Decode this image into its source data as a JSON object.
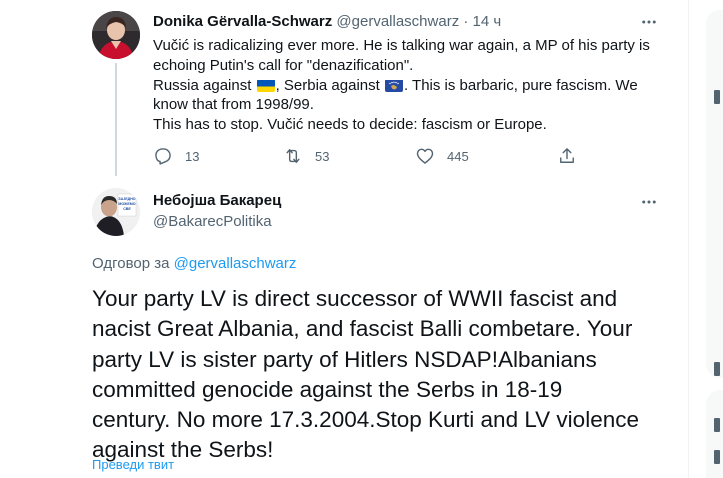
{
  "tweet": {
    "author_name": "Donika Gërvalla-Schwarz",
    "author_handle": "@gervallaschwarz",
    "separator": "·",
    "time": "14 ч",
    "text": {
      "line1": "Vučić is radicalizing ever more. He is talking war again, a MP of his party is",
      "line2": "echoing Putin's call for \"denazification\".",
      "line3_a": "Russia against ",
      "line3_b": ", Serbia against ",
      "line3_c": ". This is barbaric, pure fascism. We",
      "line4": "know that from 1998/99.",
      "line5": "This has to stop. Vučić needs to decide: fascism or Europe."
    },
    "flags": {
      "first": "ukraine-flag-icon",
      "second": "kosovo-flag-icon"
    },
    "stats": {
      "replies": "13",
      "retweets": "53",
      "likes": "445"
    }
  },
  "reply": {
    "author_name": "Небојша Бакарец",
    "author_handle": "@BakarecPolitika",
    "replying_to_label": "Одговор за",
    "replying_to_handle": "@gervallaschwarz",
    "text": {
      "line1": "Your party LV is direct successor of WWII fascist and",
      "line2": "nacist Great Albania, and fascist Balli combetare. Your",
      "line3": "party LV is sister party of Hitlers NSDAP!Albanians",
      "line4": "committed genocide against the Serbs in 18-19",
      "line5": "century. No more 17.3.2004.Stop Kurti and LV violence",
      "line6": "against the Serbs!"
    },
    "translate_label": "Преведи твит"
  },
  "avatar_badge_text": "ЗАЈЕДНО МОЖЕМО СВЕ",
  "colors": {
    "text_primary": "#0f1419",
    "text_secondary": "#536471",
    "accent": "#1d9bf0",
    "thread_line": "#cfd9de",
    "ukraine_blue": "#0057b7",
    "ukraine_yellow": "#ffd700",
    "kosovo_blue": "#244aa5",
    "kosovo_gold": "#d0a650"
  }
}
